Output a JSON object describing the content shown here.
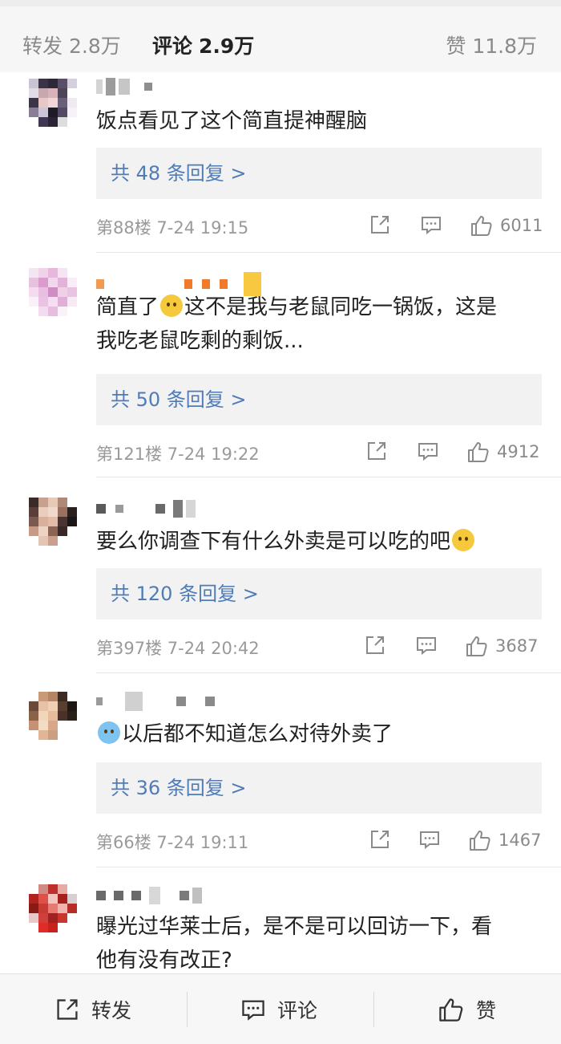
{
  "stats": {
    "repost_label": "转发",
    "repost_count": "2.8万",
    "comment_label": "评论",
    "comment_count": "2.9万",
    "like_label": "赞",
    "like_count": "11.8万"
  },
  "comments": [
    {
      "text": "饭点看见了这个简直提神醒脑",
      "reply": "共 48 条回复 >",
      "meta": "第88楼 7-24 19:15",
      "likes": "6011"
    },
    {
      "text_a": "简直了",
      "text_b": "这不是我与老鼠同吃一锅饭，这是",
      "text_c": "我吃老鼠吃剩的剩饭...",
      "reply": "共 50 条回复 >",
      "meta": "第121楼 7-24 19:22",
      "likes": "4912"
    },
    {
      "text": "要么你调查下有什么外卖是可以吃的吧",
      "reply": "共 120 条回复 >",
      "meta": "第397楼 7-24 20:42",
      "likes": "3687"
    },
    {
      "text": "以后都不知道怎么对待外卖了",
      "reply": "共 36 条回复 >",
      "meta": "第66楼 7-24 19:11",
      "likes": "1467"
    },
    {
      "text_a": "曝光过华莱士后，是不是可以回访一下，看",
      "text_b": "他有没有改正?"
    }
  ],
  "bottom": {
    "repost": "转发",
    "comment": "评论",
    "like": "赞"
  },
  "icons": [
    "share-icon",
    "comment-icon",
    "thumbs-up-icon"
  ],
  "colors": {
    "link": "#4f7bb6",
    "reply_bg": "#f2f2f2",
    "muted": "#9a9a9a"
  }
}
